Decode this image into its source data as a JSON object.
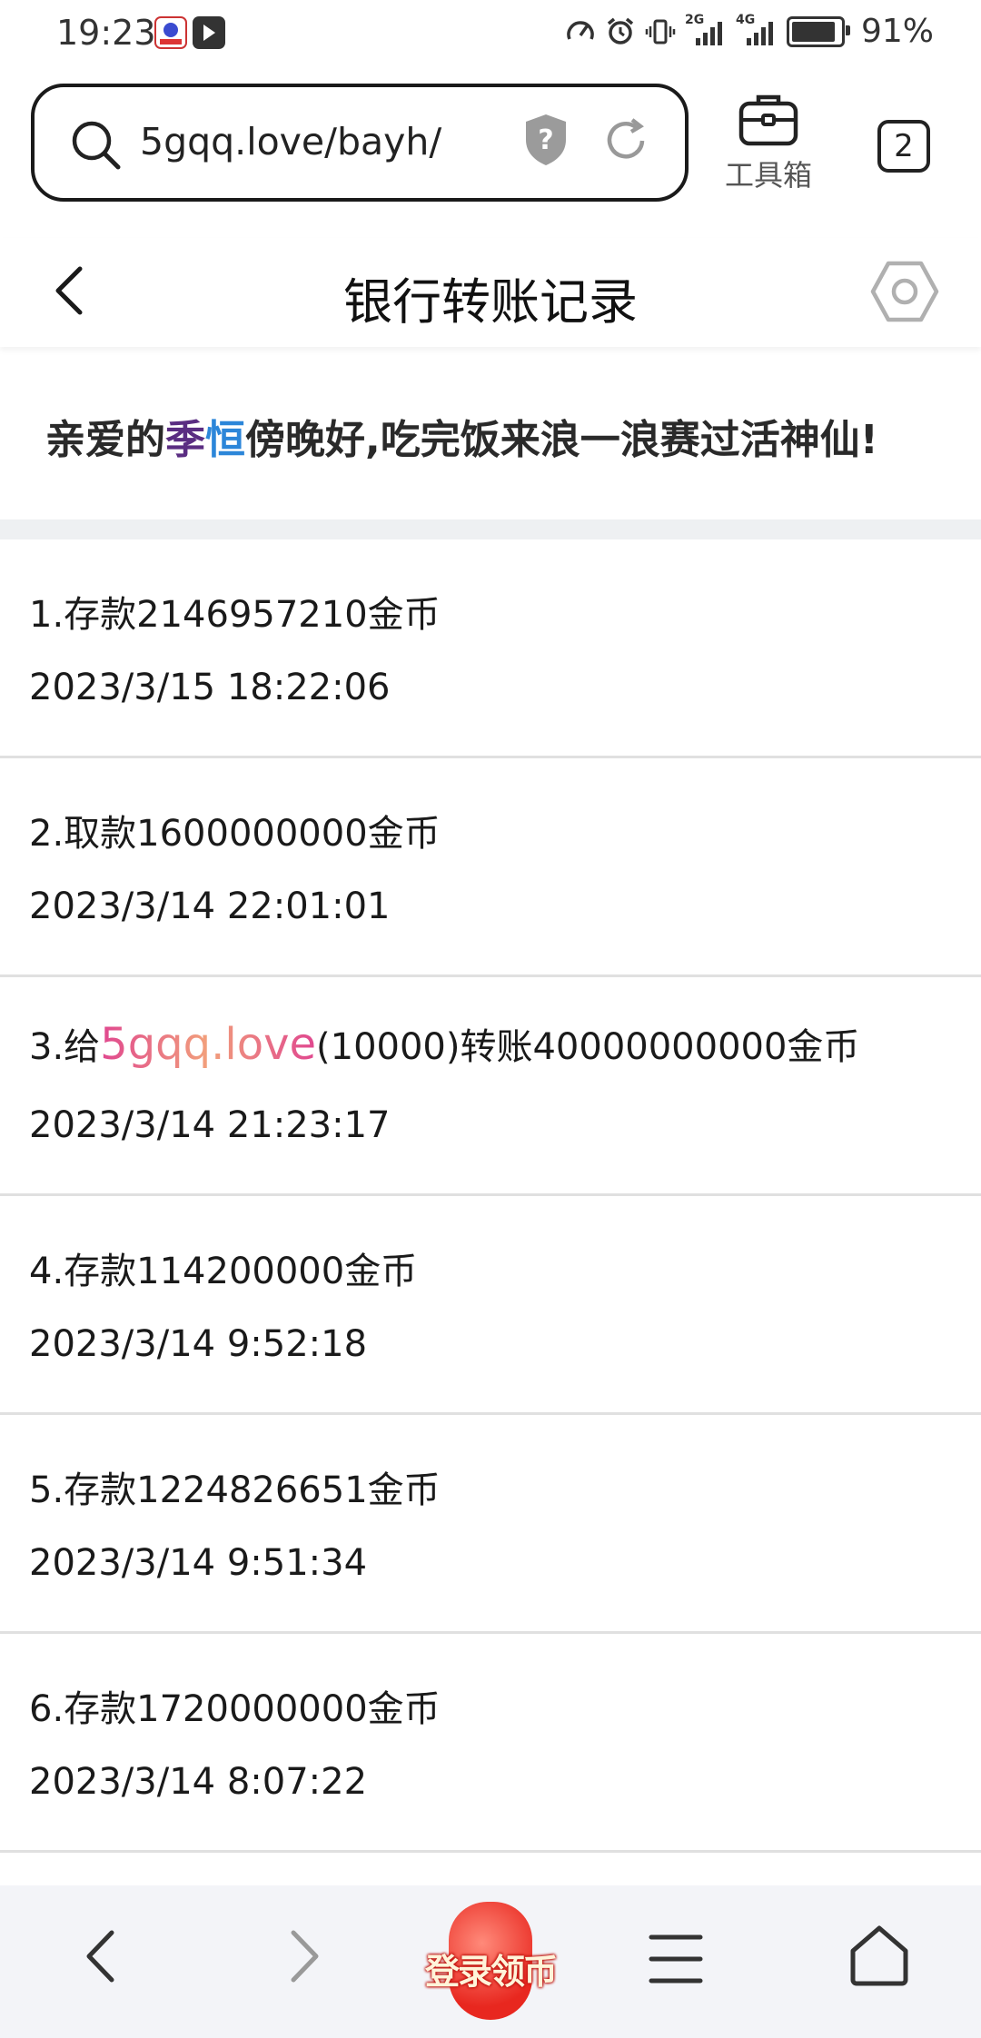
{
  "status_bar": {
    "time": "19:23",
    "network_1": "2G",
    "network_2": "4G",
    "battery": "91%",
    "battery_level": 0.91
  },
  "browser": {
    "url": "5gqq.love/bayh/",
    "toolbox_label": "工具箱",
    "tab_count": "2"
  },
  "page": {
    "title": "银行转账记录"
  },
  "greeting": {
    "prefix": "亲爱的",
    "name_part1": "季",
    "name_part2": "恒",
    "suffix": "傍晚好,吃完饭来浪一浪赛过活神仙!"
  },
  "records": [
    {
      "desc": "1.存款2146957210金币",
      "time": "2023/3/15 18:22:06"
    },
    {
      "desc": "2.取款1600000000金币",
      "time": "2023/3/14 22:01:01"
    },
    {
      "desc_prefix": "3.给",
      "site": "5gqq.love",
      "desc_suffix": "(10000)转账40000000000金币",
      "time": "2023/3/14 21:23:17"
    },
    {
      "desc": "4.存款114200000金币",
      "time": "2023/3/14 9:52:18"
    },
    {
      "desc": "5.存款1224826651金币",
      "time": "2023/3/14 9:51:34"
    },
    {
      "desc": "6.存款1720000000金币",
      "time": "2023/3/14 8:07:22"
    }
  ],
  "bottom_nav": {
    "login_coin_label": "登录领币"
  }
}
